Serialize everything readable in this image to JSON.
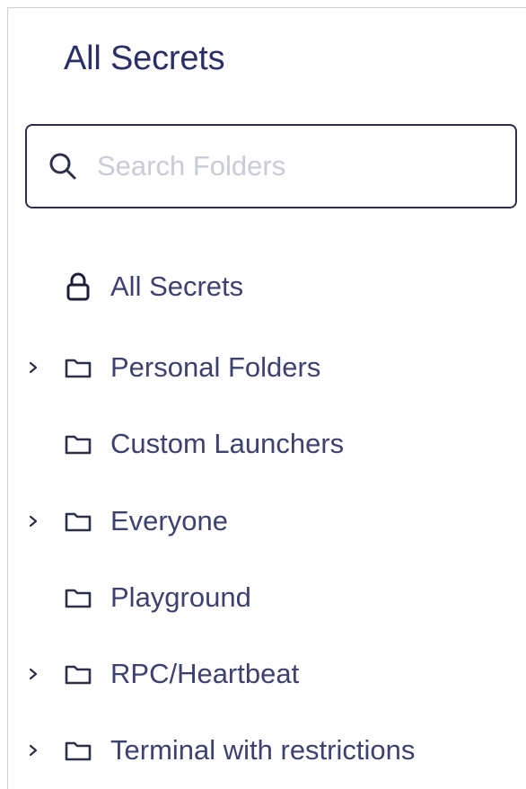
{
  "panel": {
    "title": "All Secrets"
  },
  "search": {
    "placeholder": "Search Folders",
    "value": "",
    "icon": "search-icon"
  },
  "tree": {
    "items": [
      {
        "label": "All Secrets",
        "icon": "lock-icon",
        "expandable": false
      },
      {
        "label": "Personal Folders",
        "icon": "folder-icon",
        "expandable": true
      },
      {
        "label": "Custom Launchers",
        "icon": "folder-icon",
        "expandable": false
      },
      {
        "label": "Everyone",
        "icon": "folder-icon",
        "expandable": true
      },
      {
        "label": "Playground",
        "icon": "folder-icon",
        "expandable": false
      },
      {
        "label": "RPC/Heartbeat",
        "icon": "folder-icon",
        "expandable": true
      },
      {
        "label": "Terminal with restrictions",
        "icon": "folder-icon",
        "expandable": true
      }
    ]
  },
  "colors": {
    "title": "#2b2f67",
    "label": "#3c4170",
    "border": "#2d3048",
    "placeholder": "#c9cbd6"
  }
}
